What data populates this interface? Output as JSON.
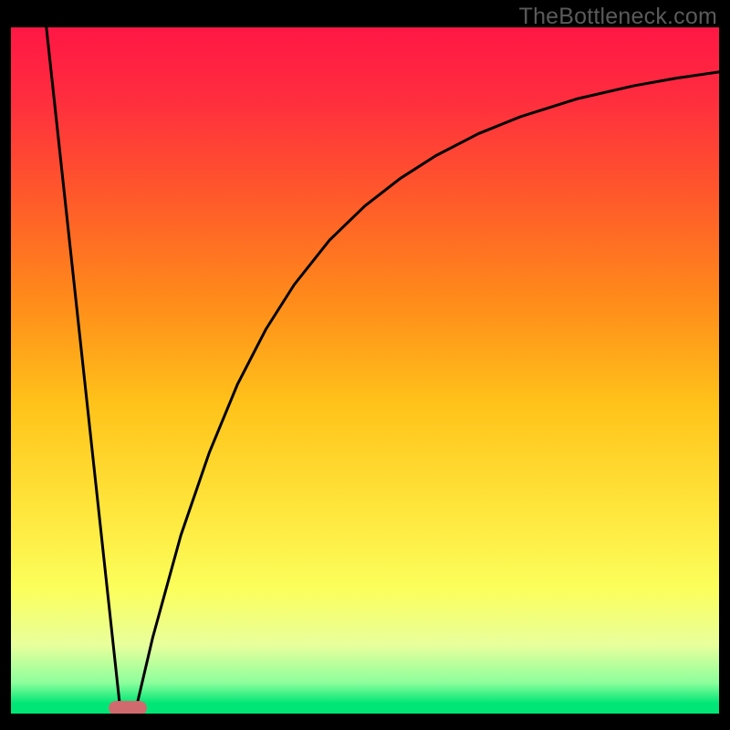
{
  "watermark": "TheBottleneck.com",
  "chart_data": {
    "type": "line",
    "title": "",
    "xlabel": "",
    "ylabel": "",
    "xlim": [
      0,
      100
    ],
    "ylim": [
      0,
      100
    ],
    "gradient_stops": [
      {
        "offset": 0.0,
        "color": "#ff1744"
      },
      {
        "offset": 0.1,
        "color": "#ff2c3f"
      },
      {
        "offset": 0.25,
        "color": "#ff5a2a"
      },
      {
        "offset": 0.4,
        "color": "#ff8c1a"
      },
      {
        "offset": 0.55,
        "color": "#ffc31a"
      },
      {
        "offset": 0.7,
        "color": "#ffe53b"
      },
      {
        "offset": 0.82,
        "color": "#fbff5c"
      },
      {
        "offset": 0.9,
        "color": "#e8ff9c"
      },
      {
        "offset": 0.955,
        "color": "#8cff9c"
      },
      {
        "offset": 0.985,
        "color": "#00e676"
      },
      {
        "offset": 1.0,
        "color": "#00e676"
      }
    ],
    "series": [
      {
        "name": "left-leg",
        "x": [
          5,
          15.5
        ],
        "y": [
          100,
          0
        ]
      },
      {
        "name": "right-curve",
        "x": [
          17.5,
          20,
          24,
          28,
          32,
          36,
          40,
          45,
          50,
          55,
          60,
          66,
          72,
          80,
          88,
          94,
          100
        ],
        "y": [
          0,
          11,
          26,
          38,
          48,
          56,
          62.5,
          69,
          74,
          78,
          81.3,
          84.5,
          87,
          89.6,
          91.5,
          92.6,
          93.5
        ]
      }
    ],
    "marker": {
      "x": 16.5,
      "y": 0.8,
      "rx": 2.7,
      "ry": 1.05,
      "fill": "#d16a6f"
    }
  }
}
